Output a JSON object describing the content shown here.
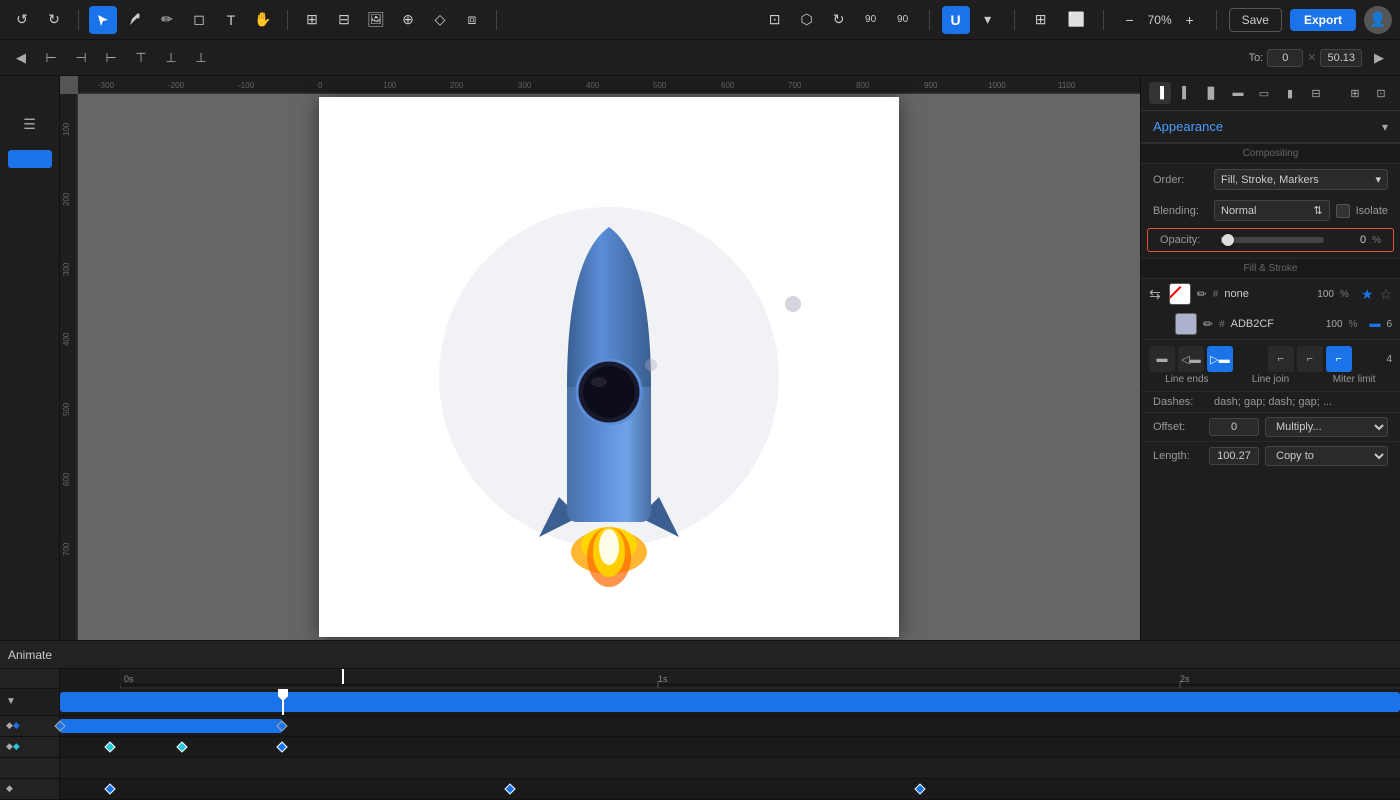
{
  "toolbar": {
    "save_label": "Save",
    "export_label": "Export",
    "zoom_level": "70%",
    "zoom_minus": "−",
    "zoom_plus": "+",
    "undo_icon": "↺",
    "redo_icon": "↻"
  },
  "secondary_toolbar": {
    "to_label": "To:",
    "to_value1": "0",
    "to_value2": "50.13"
  },
  "right_panel": {
    "appearance_title": "Appearance",
    "compositing_label": "Compositing",
    "order_label": "Order:",
    "order_value": "Fill, Stroke, Markers",
    "blending_label": "Blending:",
    "blending_value": "Normal",
    "isolate_label": "Isolate",
    "opacity_label": "Opacity:",
    "opacity_value": "0",
    "opacity_pct": "%",
    "fill_stroke_label": "Fill & Stroke",
    "fill_hash": "none",
    "fill_pct": "100",
    "stroke_hash": "ADB2CF",
    "stroke_pct": "100",
    "stroke_width": "6",
    "line_ends_label": "Line ends",
    "line_join_label": "Line join",
    "miter_label": "Miter limit",
    "miter_value": "4",
    "dashes_label": "Dashes:",
    "dashes_value": "dash; gap; dash; gap; ...",
    "offset_label": "Offset:",
    "offset_value": "0",
    "offset_blend": "Multiply...",
    "length_label": "Length:",
    "length_value": "100.27",
    "length_copy": "Copy to"
  },
  "timeline": {
    "animate_label": "Animate",
    "time_0": "0s",
    "time_1": "1s",
    "time_2": "2s"
  }
}
